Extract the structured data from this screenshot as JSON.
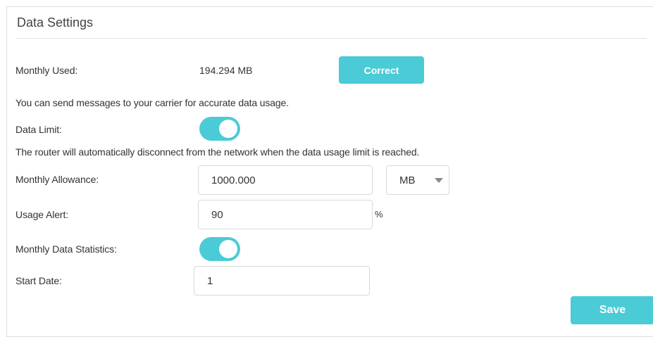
{
  "section": {
    "title": "Data Settings"
  },
  "monthly_used": {
    "label": "Monthly Used:",
    "value": "194.294 MB",
    "button": "Correct"
  },
  "carrier_info": "You can send messages to your carrier for accurate data usage.",
  "data_limit": {
    "label": "Data Limit:",
    "enabled": true
  },
  "disconnect_info": "The router will automatically disconnect from the network when the data usage limit is reached.",
  "monthly_allowance": {
    "label": "Monthly Allowance:",
    "value": "1000.000",
    "unit": "MB"
  },
  "usage_alert": {
    "label": "Usage Alert:",
    "value": "90",
    "unit": "%"
  },
  "monthly_statistics": {
    "label": "Monthly Data Statistics:",
    "enabled": true
  },
  "start_date": {
    "label": "Start Date:",
    "value": "1"
  },
  "actions": {
    "save": "Save"
  },
  "colors": {
    "accent": "#4acbd6",
    "border": "#d9d9d9",
    "text": "#333333"
  }
}
